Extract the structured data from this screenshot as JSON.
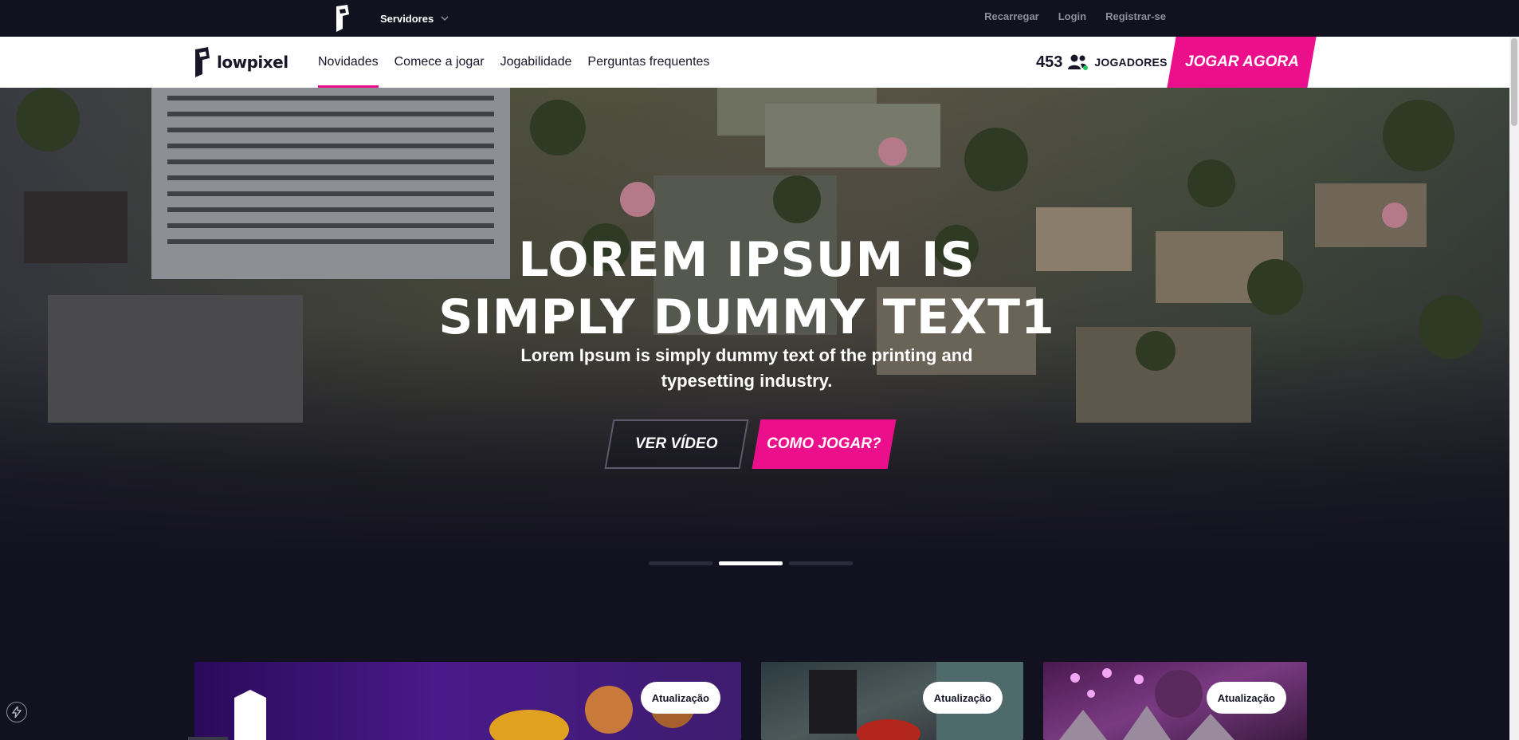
{
  "topbar": {
    "servers_label": "Servidores",
    "links": [
      "Recarregar",
      "Login",
      "Registrar-se"
    ]
  },
  "header": {
    "logo_text": "lowpixel",
    "nav": [
      "Novidades",
      "Comece a jogar",
      "Jogabilidade",
      "Perguntas frequentes"
    ],
    "active_nav": "Novidades",
    "players_count": "453",
    "players_label": "JOGADORES",
    "play_now_label": "JOGAR AGORA"
  },
  "hero": {
    "title_line1": "LOREM IPSUM IS",
    "title_line2": "SIMPLY DUMMY TEXT1",
    "subtitle_line1": "Lorem Ipsum is simply dummy text of the printing and",
    "subtitle_line2": "typesetting industry.",
    "video_button": "VER VÍDEO",
    "howto_button": "COMO JOGAR?",
    "slides_total": 3,
    "active_slide": 2
  },
  "cards": [
    {
      "badge": "Atualização"
    },
    {
      "badge": "Atualização"
    },
    {
      "badge": "Atualização"
    }
  ],
  "colors": {
    "accent": "#ec0f8c",
    "background": "#12111f",
    "nav_bg": "#ffffff"
  }
}
